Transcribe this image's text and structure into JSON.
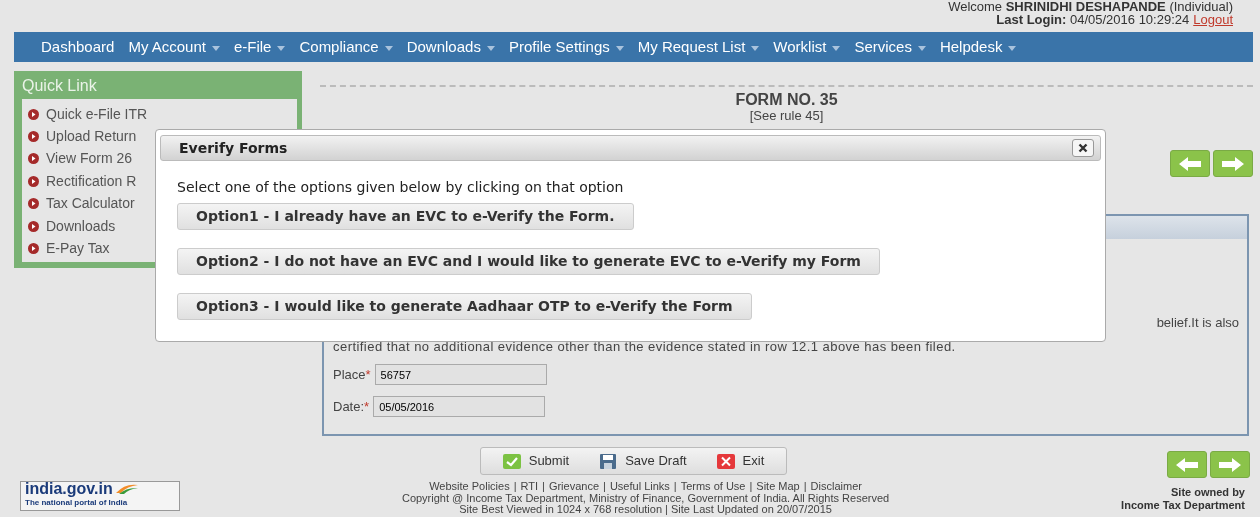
{
  "header": {
    "welcome_prefix": "Welcome",
    "user": "SHRINIDHI DESHAPANDE",
    "user_type": "(Individual)",
    "last_login_label": "Last Login:",
    "last_login": "04/05/2016 10:29:24",
    "logout": "Logout"
  },
  "nav": [
    {
      "label": "Dashboard",
      "dropdown": false
    },
    {
      "label": "My Account",
      "dropdown": true
    },
    {
      "label": "e-File",
      "dropdown": true
    },
    {
      "label": "Compliance",
      "dropdown": true
    },
    {
      "label": "Downloads",
      "dropdown": true
    },
    {
      "label": "Profile Settings",
      "dropdown": true
    },
    {
      "label": "My Request List",
      "dropdown": true
    },
    {
      "label": "Worklist",
      "dropdown": true
    },
    {
      "label": "Services",
      "dropdown": true
    },
    {
      "label": "Helpdesk",
      "dropdown": true
    }
  ],
  "quick_link": {
    "title": "Quick Link",
    "items": [
      "Quick e-File ITR",
      "Upload Return",
      "View Form 26",
      "Rectification R",
      "Tax Calculator",
      "Downloads",
      "E-Pay Tax"
    ]
  },
  "form": {
    "title": "FORM NO. 35",
    "subtitle": "[See rule 45]",
    "text_tail": "belief.It is also",
    "text_line": "certified that no additional evidence other than the evidence stated in row 12.1 above has been filed.",
    "fields": [
      {
        "label": "Place",
        "required_mark": "*",
        "value": "56757"
      },
      {
        "label": "Date:",
        "required_mark": "*",
        "value": "05/05/2016"
      }
    ]
  },
  "actions": [
    {
      "label": "Submit",
      "kind": "submit"
    },
    {
      "label": "Save Draft",
      "kind": "save"
    },
    {
      "label": "Exit",
      "kind": "exit"
    }
  ],
  "footer": {
    "logo_text": "india.gov.in",
    "logo_tagline": "The national portal of India",
    "separator": "|",
    "links": [
      "Website Policies",
      "RTI",
      "Grievance",
      "Useful Links",
      "Terms of Use",
      "Site Map",
      "Disclaimer"
    ],
    "copyright": "Copyright @ Income Tax Department, Ministry of Finance, Government of India. All Rights Reserved",
    "best_viewed": "Site Best Viewed in 1024 x 768 resolution | Site Last Updated on 20/07/2015",
    "owner_line1": "Site owned by",
    "owner_line2": "Income Tax Department"
  },
  "dialog": {
    "title": "Everify Forms",
    "prompt": "Select one of the options given below by clicking on that option",
    "options": [
      "Option1 - I already have an EVC to e-Verify the Form.",
      "Option2 - I do not have an EVC and I would like to generate EVC to e-Verify my Form",
      "Option3 - I would like to generate Aadhaar OTP to e-Verify the Form"
    ]
  }
}
